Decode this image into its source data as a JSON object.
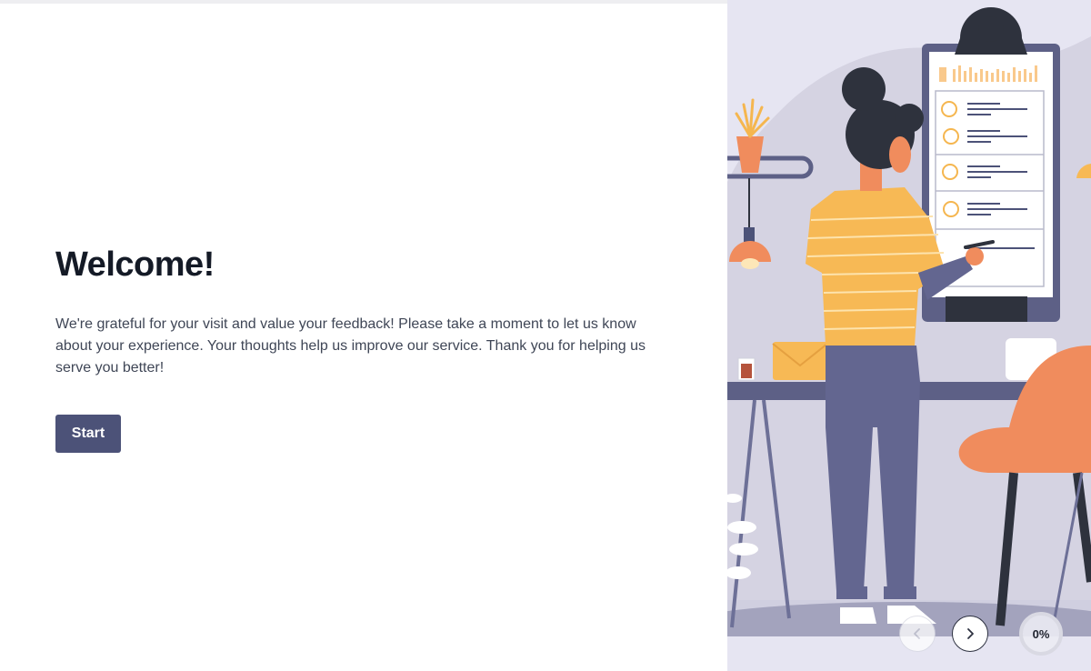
{
  "progress": {
    "percent": 0,
    "label": "0%"
  },
  "welcome": {
    "title": "Welcome!",
    "message": "We're grateful for your visit and value your feedback! Please take a moment to let us know about your experience. Your thoughts help us improve our service. Thank you for helping us serve you better!",
    "start_label": "Start"
  },
  "navigation": {
    "prev_icon": "chevron-left-icon",
    "next_icon": "chevron-right-icon"
  },
  "colors": {
    "accent": "#4c5278",
    "illustration_bg": "#e6e5f2",
    "shirt": "#f7b955",
    "pants": "#636690",
    "chair": "#f08c5d"
  }
}
